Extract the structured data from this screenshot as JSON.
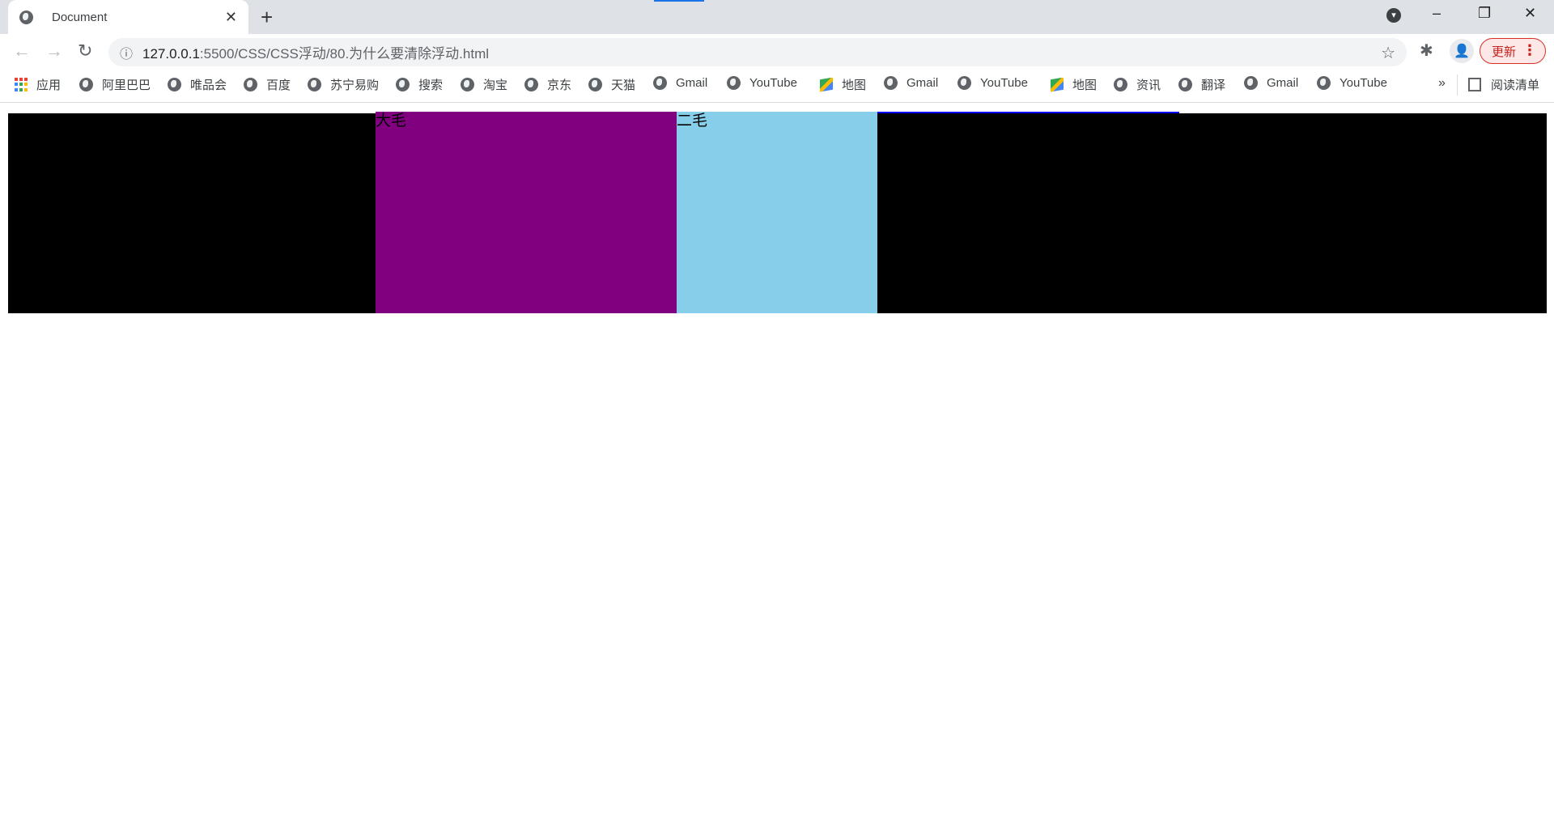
{
  "tab": {
    "title": "Document",
    "close": "✕",
    "new_tab": "+"
  },
  "window": {
    "minimize": "–",
    "restore": "❐",
    "close": "✕",
    "profile_menu": "▾"
  },
  "toolbar": {
    "back": "←",
    "forward": "→",
    "reload": "↻",
    "info": "ⓘ",
    "url_host": "127.0.0.1",
    "url_rest": ":5500/CSS/CSS浮动/80.为什么要清除浮动.html",
    "star": "☆",
    "extensions": "✱",
    "avatar": "👤",
    "update_label": "更新",
    "menu": "⋮"
  },
  "bookmarks": {
    "apps_label": "应用",
    "items": [
      {
        "label": "阿里巴巴",
        "icon": "globe-icon"
      },
      {
        "label": "唯品会",
        "icon": "globe-icon"
      },
      {
        "label": "百度",
        "icon": "globe-icon"
      },
      {
        "label": "苏宁易购",
        "icon": "globe-icon"
      },
      {
        "label": "搜索",
        "icon": "globe-icon"
      },
      {
        "label": "淘宝",
        "icon": "globe-icon"
      },
      {
        "label": "京东",
        "icon": "globe-icon"
      },
      {
        "label": "天猫",
        "icon": "globe-icon"
      },
      {
        "label": "Gmail",
        "icon": "globe-icon"
      },
      {
        "label": "YouTube",
        "icon": "globe-icon"
      },
      {
        "label": "地图",
        "icon": "maps-icon"
      },
      {
        "label": "Gmail",
        "icon": "globe-icon"
      },
      {
        "label": "YouTube",
        "icon": "globe-icon"
      },
      {
        "label": "地图",
        "icon": "maps-icon"
      },
      {
        "label": "资讯",
        "icon": "globe-icon"
      },
      {
        "label": "翻译",
        "icon": "globe-icon"
      },
      {
        "label": "Gmail",
        "icon": "globe-icon"
      },
      {
        "label": "YouTube",
        "icon": "globe-icon"
      }
    ],
    "more": "»",
    "reading_list": "阅读清单"
  },
  "page": {
    "box1": "大毛",
    "box2": "二毛",
    "colors": {
      "outer": "#000000",
      "box1": "#800080",
      "box2": "#87ceeb",
      "border": "#0000ff"
    }
  }
}
